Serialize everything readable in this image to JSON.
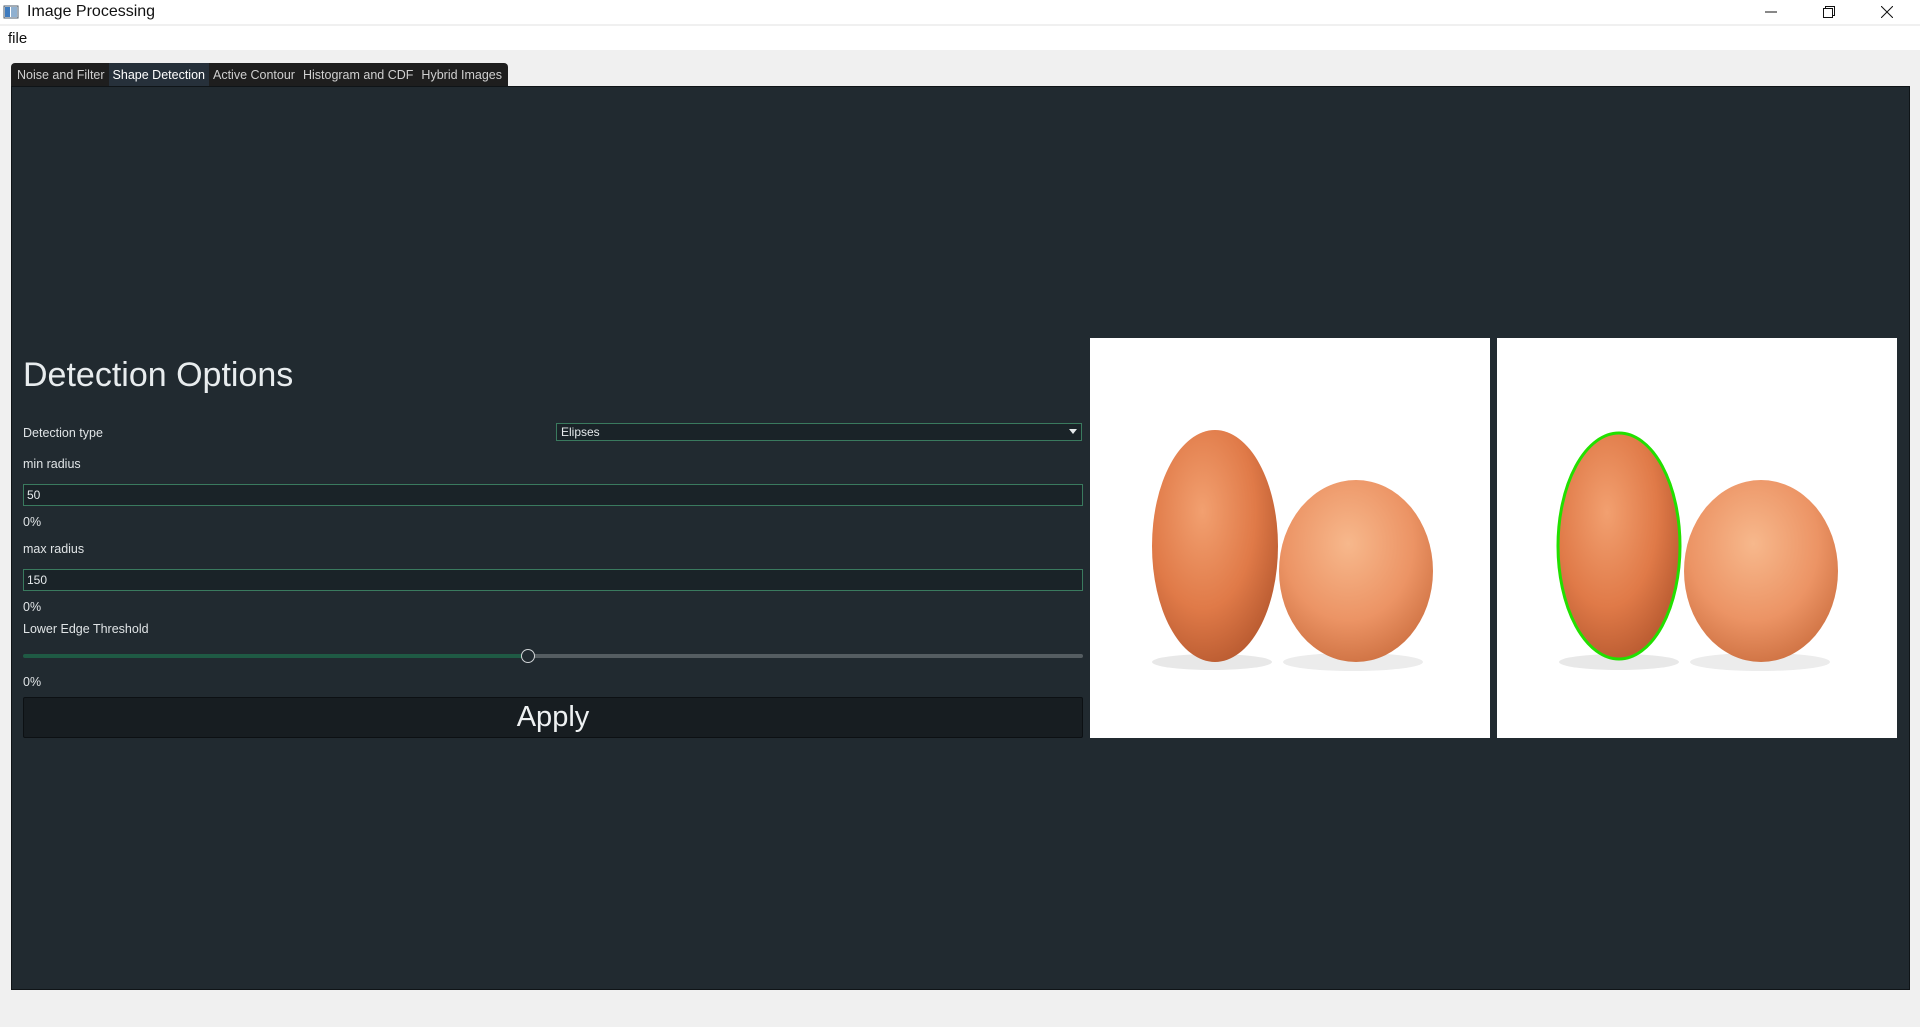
{
  "window": {
    "title": "Image Processing",
    "icon": "app-window-icon",
    "controls": [
      "minimize-icon",
      "restore-icon",
      "close-icon"
    ]
  },
  "menu": {
    "file_label": "file"
  },
  "tabs": [
    {
      "label": "Noise and Filter",
      "active": false
    },
    {
      "label": "Shape Detection",
      "active": true
    },
    {
      "label": "Active Contour",
      "active": false
    },
    {
      "label": "Histogram and CDF",
      "active": false
    },
    {
      "label": "Hybrid Images",
      "active": false
    }
  ],
  "options": {
    "heading": "Detection Options",
    "detection_type_label": "Detection type",
    "detection_type_value": "Elipses",
    "min_radius_label": "min radius",
    "min_radius_value": "50",
    "min_radius_percent": "0%",
    "max_radius_label": "max radius",
    "max_radius_value": "150",
    "max_radius_percent": "0%",
    "threshold_label": "Lower Edge Threshold",
    "threshold_percent": "0%",
    "threshold_level": 0.476,
    "apply_label": "Apply"
  },
  "colors": {
    "panel_bg": "#212a30",
    "accent_border": "#3a7a5e",
    "detection_outline": "#22e000"
  }
}
